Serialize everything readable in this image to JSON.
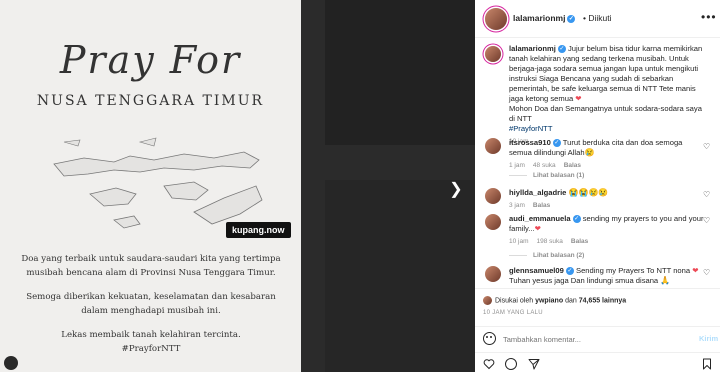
{
  "image": {
    "title": "Pray For",
    "subtitle": "NUSA TENGGARA TIMUR",
    "watermark": "kupang.now",
    "caption_lines": [
      "Doa yang terbaik untuk saudara-saudari kita yang tertimpa musibah bencana alam di Provinsi Nusa Tenggara Timur.",
      "Semoga diberikan kekuatan, keselamatan dan kesabaran dalam menghadapi musibah ini.",
      "Lekas membaik tanah kelahiran tercinta.",
      "#PrayforNTT"
    ]
  },
  "header": {
    "username": "lalamarionmj",
    "follow_label": "• Diikuti",
    "more_label": "•••"
  },
  "caption": {
    "username": "lalamarionmj",
    "text": "Jujur belum bisa tidur karna memikirkan tanah kelahiran yang sedang terkena musibah. Untuk berjaga-jaga sodara semua jangan lupa untuk mengikuti instruksi Siaga Bencana yang sudah di sebarkan pemerintah, be safe keluarga semua di NTT Tete manis jaga ketong semua",
    "text2": "Mohon Doa dan Semangatnya untuk sodara-sodara saya di NTT",
    "hashtag": "#PrayforNTT",
    "time": "10 jam"
  },
  "comments": [
    {
      "username": "itsrossa910",
      "text": "Turut berduka cita dan doa semoga semua dilindungi Allah",
      "emoji": "😢",
      "time": "1 jam",
      "likes": "48 suka",
      "reply": "Balas",
      "view_replies": "Lihat balasan (1)"
    },
    {
      "username": "hiyllda_algadrie",
      "text": "",
      "emoji": "😭😭😢😢",
      "time": "3 jam",
      "likes": "",
      "reply": "Balas",
      "view_replies": ""
    },
    {
      "username": "audi_emmanuela",
      "text": "sending my prayers to you and your family...",
      "emoji": "",
      "time": "10 jam",
      "likes": "198 suka",
      "reply": "Balas",
      "view_replies": "Lihat balasan (2)"
    },
    {
      "username": "glennsamuel09",
      "text": "Sending my Prayers To NTT nona",
      "text2": "Tuhan yesus jaga Dan lindungi smua disana",
      "emoji": "🙏",
      "time": "10 jam",
      "likes": "",
      "reply": "Balas",
      "view_replies": ""
    }
  ],
  "likes": {
    "prefix": "Disukai oleh",
    "user": "ywpiano",
    "middle": "dan",
    "count": "74,655 lainnya"
  },
  "time_ago": "10 JAM YANG LALU",
  "add_comment": {
    "placeholder": "Tambahkan komentar...",
    "post_label": "Kirim"
  },
  "icons": [
    "heart-icon",
    "comment-icon",
    "share-icon",
    "bookmark-icon",
    "emoji-icon",
    "close-icon",
    "chevron-right-icon",
    "user-icon"
  ],
  "colors": {
    "verified": "#3897f0",
    "hashtag": "#00376b",
    "heart": "#ed4956",
    "post_disabled": "#b2dffc"
  }
}
